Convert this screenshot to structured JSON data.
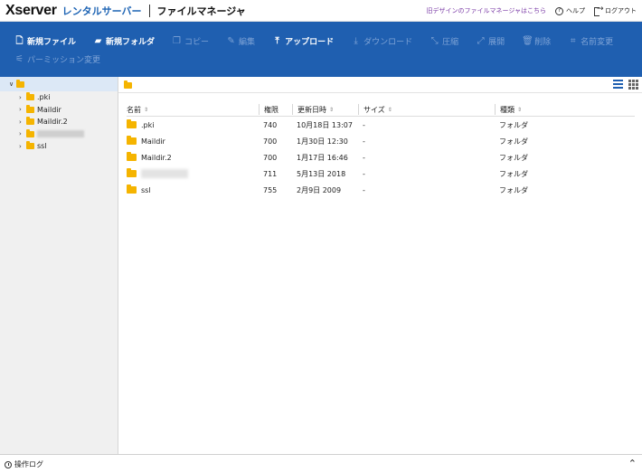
{
  "header": {
    "logo_main": "Xserver",
    "logo_sub": "レンタルサーバー",
    "app_title": "ファイルマネージャ",
    "old_design_link": "旧デザインのファイルマネージャはこちら",
    "help_label": "ヘルプ",
    "logout_label": "ログアウト"
  },
  "toolbar": {
    "row1": [
      {
        "label": "新規ファイル",
        "icon": "new-file-icon",
        "enabled": true
      },
      {
        "label": "新規フォルダ",
        "icon": "new-folder-icon",
        "enabled": true
      },
      {
        "label": "コピー",
        "icon": "copy-icon",
        "enabled": false
      },
      {
        "label": "編集",
        "icon": "edit-icon",
        "enabled": false
      },
      {
        "label": "アップロード",
        "icon": "upload-icon",
        "enabled": true
      },
      {
        "label": "ダウンロード",
        "icon": "download-icon",
        "enabled": false
      },
      {
        "label": "圧縮",
        "icon": "compress-icon",
        "enabled": false
      },
      {
        "label": "展開",
        "icon": "extract-icon",
        "enabled": false
      },
      {
        "label": "削除",
        "icon": "trash-icon",
        "enabled": false
      },
      {
        "label": "名前変更",
        "icon": "rename-icon",
        "enabled": false
      }
    ],
    "row2": [
      {
        "label": "パーミッション変更",
        "icon": "permission-icon",
        "enabled": false
      }
    ]
  },
  "tree": {
    "items": [
      {
        "label": ".pki"
      },
      {
        "label": "Maildir"
      },
      {
        "label": "Maildir.2"
      },
      {
        "label": "",
        "redacted": true
      },
      {
        "label": "ssl"
      }
    ]
  },
  "table": {
    "headers": {
      "name": "名前",
      "perm": "権限",
      "date": "更新日時",
      "size": "サイズ",
      "type": "種類"
    },
    "rows": [
      {
        "name": ".pki",
        "perm": "740",
        "date": "10月18日 13:07",
        "size": "-",
        "type": "フォルダ"
      },
      {
        "name": "Maildir",
        "perm": "700",
        "date": "1月30日 12:30",
        "size": "-",
        "type": "フォルダ"
      },
      {
        "name": "Maildir.2",
        "perm": "700",
        "date": "1月17日 16:46",
        "size": "-",
        "type": "フォルダ"
      },
      {
        "name": "",
        "perm": "711",
        "date": "5月13日 2018",
        "size": "-",
        "type": "フォルダ",
        "redacted": true
      },
      {
        "name": "ssl",
        "perm": "755",
        "date": "2月9日 2009",
        "size": "-",
        "type": "フォルダ"
      }
    ]
  },
  "footer": {
    "log_label": "操作ログ"
  },
  "colors": {
    "toolbar_bg": "#1f5fb0",
    "folder": "#f5b400",
    "brand_blue": "#1e64b4",
    "link_purple": "#7a3aa6"
  }
}
